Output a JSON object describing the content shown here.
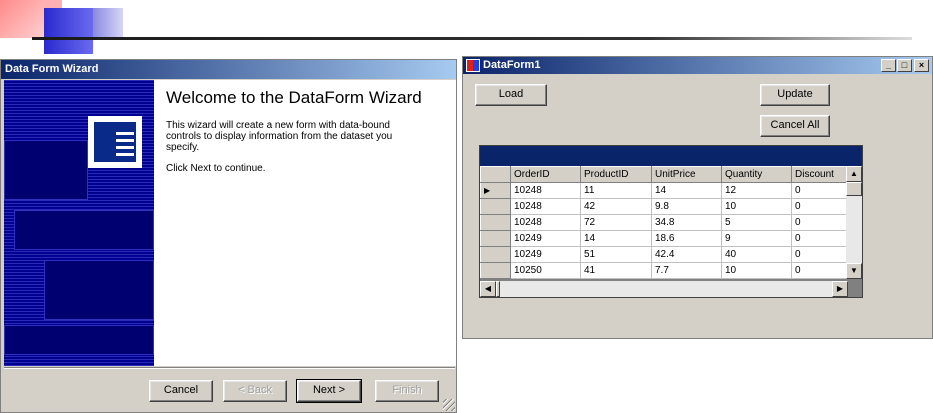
{
  "wizard": {
    "title": "Data Form Wizard",
    "heading": "Welcome to the DataForm Wizard",
    "description": "This wizard will create a new form with data-bound controls to display information from the dataset you specify.",
    "instruction": "Click Next to continue.",
    "buttons": {
      "cancel": "Cancel",
      "back": "< Back",
      "next": "Next >",
      "finish": "Finish"
    }
  },
  "dataform": {
    "title": "DataForm1",
    "caption_buttons": {
      "minimize": "_",
      "maximize": "□",
      "close": "×"
    },
    "buttons": {
      "load": "Load",
      "update": "Update",
      "cancel_all": "Cancel All"
    },
    "grid": {
      "columns": [
        "OrderID",
        "ProductID",
        "UnitPrice",
        "Quantity",
        "Discount"
      ],
      "rows": [
        [
          "10248",
          "11",
          "14",
          "12",
          "0"
        ],
        [
          "10248",
          "42",
          "9.8",
          "10",
          "0"
        ],
        [
          "10248",
          "72",
          "34.8",
          "5",
          "0"
        ],
        [
          "10249",
          "14",
          "18.6",
          "9",
          "0"
        ],
        [
          "10249",
          "51",
          "42.4",
          "40",
          "0"
        ],
        [
          "10250",
          "41",
          "7.7",
          "10",
          "0"
        ]
      ],
      "current_row_marker": "▶"
    }
  },
  "colors": {
    "titlebar": "#0a246a",
    "wizard_sidebar": "#000090",
    "face": "#d4d0c8"
  }
}
